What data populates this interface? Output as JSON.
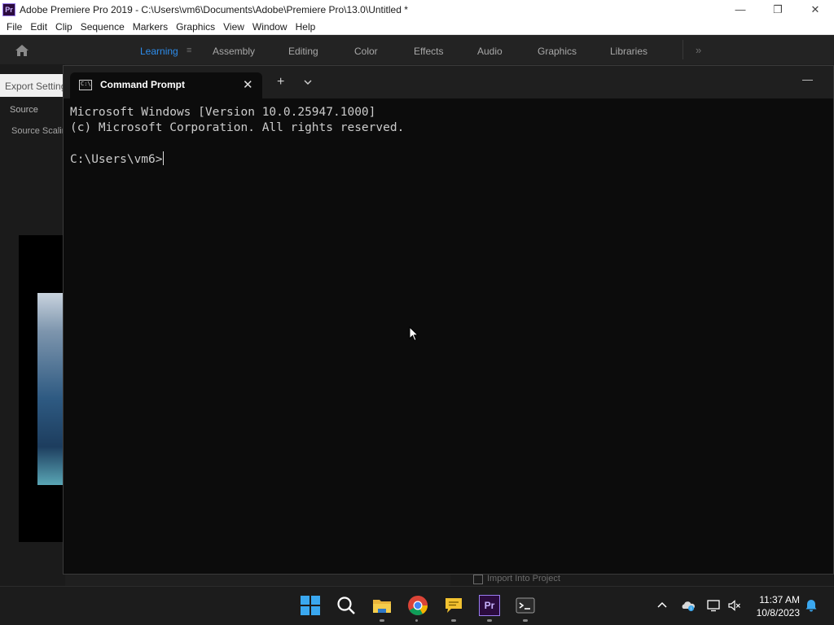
{
  "premiere": {
    "title": "Adobe Premiere Pro 2019 - C:\\Users\\vm6\\Documents\\Adobe\\Premiere Pro\\13.0\\Untitled *",
    "logo_text": "Pr",
    "menu": [
      "File",
      "Edit",
      "Clip",
      "Sequence",
      "Markers",
      "Graphics",
      "View",
      "Window",
      "Help"
    ],
    "workspaces": [
      "Learning",
      "Assembly",
      "Editing",
      "Color",
      "Effects",
      "Audio",
      "Graphics",
      "Libraries"
    ],
    "active_workspace": "Learning",
    "workspace_menu_glyph": "≡",
    "more_glyph": "»",
    "export_settings_tab": "Export Settings",
    "source_tab": "Source",
    "source_scaling_label": "Source Scaling",
    "import_into_project": "Import Into Project",
    "window_controls": [
      "—",
      "❐",
      "✕"
    ]
  },
  "cmd": {
    "tab_title": "Command Prompt",
    "close_glyph": "✕",
    "new_tab_glyph": "+",
    "minimize_glyph": "—",
    "lines": [
      "Microsoft Windows [Version 10.0.25947.1000]",
      "(c) Microsoft Corporation. All rights reserved.",
      "",
      "C:\\Users\\vm6>"
    ]
  },
  "taskbar": {
    "time": "11:37 AM",
    "date": "10/8/2023",
    "pinned_icons": [
      "windows-start-icon",
      "search-icon",
      "file-explorer-icon",
      "chrome-icon",
      "feedback-hub-icon",
      "premiere-pro-icon",
      "terminal-icon"
    ],
    "premiere_icon_text": "Pr",
    "tray_icons": [
      "chevron-up-icon",
      "onedrive-icon",
      "display-icon",
      "volume-muted-icon",
      "notification-bell-icon"
    ]
  },
  "colors": {
    "accent_blue": "#2d8ceb",
    "cmd_background": "#0c0c0c",
    "taskbar_background": "#1c1c1c"
  }
}
